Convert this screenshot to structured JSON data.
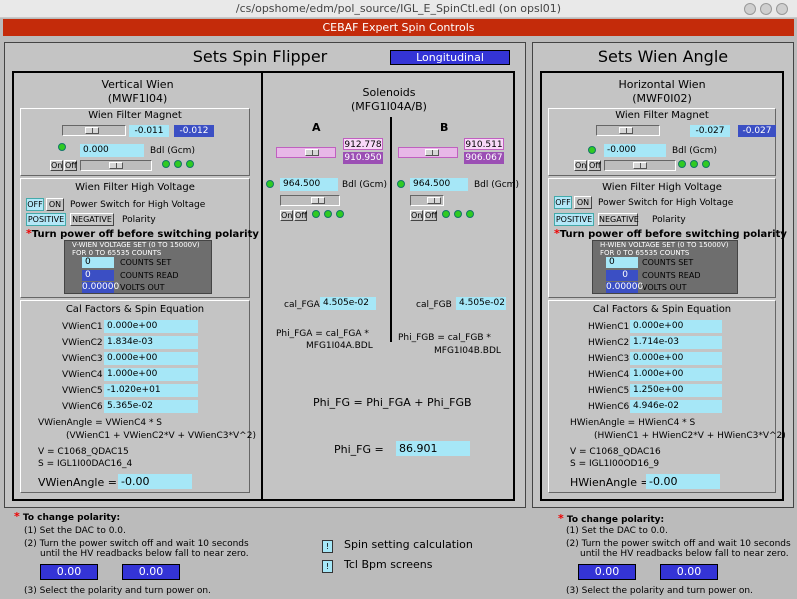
{
  "window": {
    "title": "/cs/opshome/edm/pol_source/IGL_E_SpinCtl.edl (on opsl01)"
  },
  "banner": "CEBAF Expert Spin Controls",
  "flipper": {
    "title": "Sets Spin Flipper",
    "mode": "Longitudinal"
  },
  "wienangle": {
    "title": "Sets Wien Angle"
  },
  "vwien": {
    "title": "Vertical Wien",
    "subtitle": "(MWF1I04)",
    "wf_magnet": "Wien Filter Magnet",
    "mag_set": "-0.011",
    "mag_read": "-0.012",
    "bdl_set": "0.000",
    "bdl_label": "Bdl (Gcm)",
    "on": "On",
    "off": "Off",
    "hv_title": "Wien Filter High Voltage",
    "hv_off": "OFF",
    "hv_on": "ON",
    "hv_switch_label": "Power Switch for High Voltage",
    "pos": "POSITIVE",
    "neg": "NEGATIVE",
    "polarity": "Polarity",
    "warning": "Turn power off before switching polarity",
    "vs_title1": "V-WIEN VOLTAGE SET (0 TO 15000V)",
    "vs_title2": "FOR 0 TO 65535 COUNTS",
    "counts_set": "0",
    "counts_set_label": "COUNTS SET",
    "counts_read": "0",
    "counts_read_label": "COUNTS READ",
    "volts_out": "0.00000",
    "volts_out_label": "VOLTS OUT",
    "cal_title": "Cal Factors & Spin Equation",
    "cal": [
      {
        "label": "VWienC1",
        "value": "0.000e+00"
      },
      {
        "label": "VWienC2",
        "value": "1.834e-03"
      },
      {
        "label": "VWienC3",
        "value": "0.000e+00"
      },
      {
        "label": "VWienC4",
        "value": "1.000e+00"
      },
      {
        "label": "VWienC5",
        "value": "-1.020e+01"
      },
      {
        "label": "VWienC6",
        "value": "5.365e-02"
      }
    ],
    "eq1": "VWienAngle = VWienC4 * S",
    "eq2": "(VWienC1 + VWienC2*V + VWienC3*V^2)",
    "eq3": "V = C1068_QDAC15",
    "eq4": "S = IGL1I00DAC16_4",
    "angle_label": "VWienAngle =",
    "angle_value": "-0.00"
  },
  "solenoids": {
    "title": "Solenoids",
    "subtitle": "(MFG1I04A/B)",
    "a": {
      "label": "A",
      "set": "912.778",
      "read": "910.950",
      "bdl": "964.500",
      "bdl_label": "Bdl (Gcm)",
      "on": "On",
      "off": "Off",
      "cal_label": "cal_FGA",
      "cal_value": "4.505e-02",
      "eq1": "Phi_FGA = cal_FGA *",
      "eq2": "MFG1I04A.BDL"
    },
    "b": {
      "label": "B",
      "set": "910.511",
      "read": "906.067",
      "bdl": "964.500",
      "bdl_label": "Bdl (Gcm)",
      "on": "On",
      "off": "Off",
      "cal_label": "cal_FGB",
      "cal_value": "4.505e-02",
      "eq1": "Phi_FGB = cal_FGB *",
      "eq2": "MFG1I04B.BDL"
    },
    "sum": "Phi_FG = Phi_FGA + Phi_FGB",
    "phi_label": "Phi_FG =",
    "phi_value": "86.901"
  },
  "hwien": {
    "title": "Horizontal Wien",
    "subtitle": "(MWF0I02)",
    "wf_magnet": "Wien Filter Magnet",
    "mag_set": "-0.027",
    "mag_read": "-0.027",
    "bdl_set": "-0.000",
    "bdl_label": "Bdl (Gcm)",
    "on": "On",
    "off": "Off",
    "hv_title": "Wien Filter High Voltage",
    "hv_off": "OFF",
    "hv_on": "ON",
    "hv_switch_label": "Power Switch for High Voltage",
    "pos": "POSITIVE",
    "neg": "NEGATIVE",
    "polarity": "Polarity",
    "warning": "Turn power off before switching polarity",
    "vs_title1": "H-WIEN VOLTAGE SET (0 TO 15000V)",
    "vs_title2": "FOR 0 TO 65535 COUNTS",
    "counts_set": "0",
    "counts_set_label": "COUNTS SET",
    "counts_read": "0",
    "counts_read_label": "COUNTS READ",
    "volts_out": "0.00000",
    "volts_out_label": "VOLTS OUT",
    "cal_title": "Cal Factors & Spin Equation",
    "cal": [
      {
        "label": "HWienC1",
        "value": "0.000e+00"
      },
      {
        "label": "HWienC2",
        "value": "1.714e-03"
      },
      {
        "label": "HWienC3",
        "value": "0.000e+00"
      },
      {
        "label": "HWienC4",
        "value": "1.000e+00"
      },
      {
        "label": "HWienC5",
        "value": "1.250e+00"
      },
      {
        "label": "HWienC6",
        "value": "4.946e-02"
      }
    ],
    "eq1": "HWienAngle = HWienC4 * S",
    "eq2": "(HWienC1 + HWienC2*V + HWienC3*V^2)",
    "eq3": "V = C1068_QDAC16",
    "eq4": "S = IGL1I00OD16_9",
    "angle_label": "HWienAngle =",
    "angle_value": "-0.00"
  },
  "notes": {
    "title": "To change polarity:",
    "step1": "(1) Set the DAC to 0.0.",
    "step2a": "(2) Turn the power switch off and wait 10 seconds",
    "step2b": "until the HV readbacks below fall to near zero.",
    "step3": "(3) Select the polarity and turn power on.",
    "left_v1": "0.00",
    "left_v2": "0.00",
    "right_v1": "0.00",
    "right_v2": "0.00"
  },
  "links": {
    "spin": "Spin setting calculation",
    "tcl": "Tcl Bpm screens"
  }
}
